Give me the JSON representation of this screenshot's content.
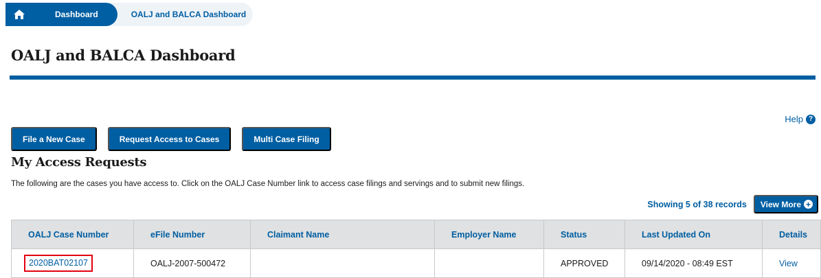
{
  "breadcrumb": {
    "home_icon": "home-icon",
    "items": [
      "Dashboard",
      "OALJ and BALCA Dashboard"
    ]
  },
  "page_title": "OALJ and BALCA Dashboard",
  "help": {
    "label": "Help",
    "icon": "question-circle-icon"
  },
  "actions": {
    "file_new_case": "File a New Case",
    "request_access": "Request Access to Cases",
    "multi_case_filing": "Multi Case Filing"
  },
  "access_requests": {
    "title": "My Access Requests",
    "description": "The following are the cases you have access to. Click on the OALJ Case Number link to access case filings and servings and to submit new filings.",
    "records_label": "Showing 5 of 38 records",
    "view_more": "View More",
    "columns": [
      "OALJ Case Number",
      "eFile Number",
      "Claimant Name",
      "Employer Name",
      "Status",
      "Last Updated On",
      "Details"
    ],
    "rows": [
      {
        "case_number": "2020BAT02107",
        "efile_number": "OALJ-2007-500472",
        "claimant_name": "",
        "employer_name": "",
        "status": "APPROVED",
        "last_updated": "09/14/2020 - 08:49 EST",
        "details": "View"
      }
    ]
  },
  "colors": {
    "primary": "#005ea2",
    "highlight": "#e2000f",
    "header_bg": "#dfe1e2"
  }
}
